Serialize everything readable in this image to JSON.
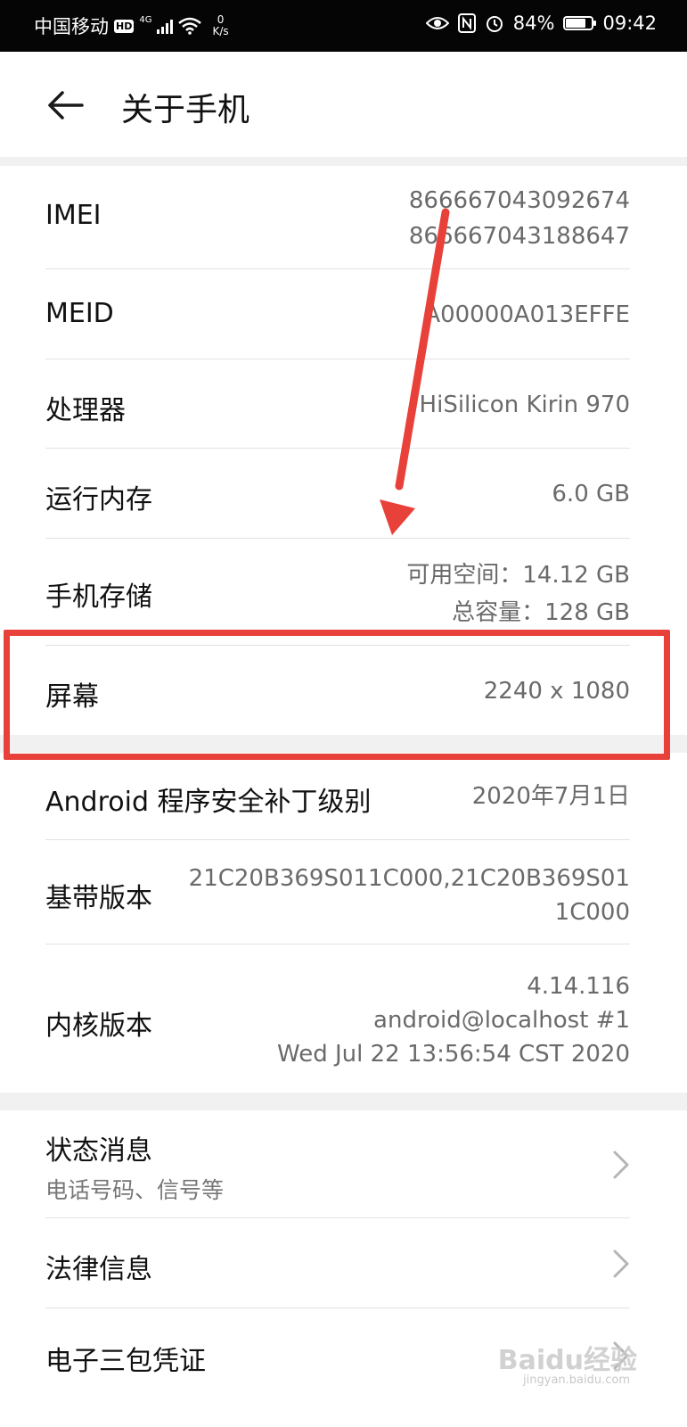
{
  "status_bar": {
    "carrier": "中国移动",
    "hd": "HD",
    "network": "4G",
    "speed_value": "0",
    "speed_unit": "K/s",
    "battery": "84%",
    "battery_level": 0.84,
    "time": "09:42"
  },
  "header": {
    "title": "关于手机"
  },
  "items": {
    "imei": {
      "label": "IMEI",
      "value1": "866667043092674",
      "value2": "866667043188647"
    },
    "meid": {
      "label": "MEID",
      "value": "A00000A013EFFE"
    },
    "processor": {
      "label": "处理器",
      "value": "HiSilicon Kirin 970"
    },
    "ram": {
      "label": "运行内存",
      "value": "6.0 GB"
    },
    "storage": {
      "label": "手机存储",
      "value1": "可用空间：14.12  GB",
      "value2": "总容量：128  GB"
    },
    "screen": {
      "label": "屏幕",
      "value": "2240 x 1080"
    },
    "security_patch": {
      "label": "Android 程序安全补丁级别",
      "value": "2020年7月1日"
    },
    "baseband": {
      "label": "基带版本",
      "value1": "21C20B369S011C000,21C20B369S01",
      "value2": "1C000"
    },
    "kernel": {
      "label": "内核版本",
      "value1": "4.14.116",
      "value2": "android@localhost #1",
      "value3": "Wed Jul 22 13:56:54 CST 2020"
    }
  },
  "nav_items": {
    "status": {
      "label": "状态消息",
      "sub": "电话号码、信号等"
    },
    "legal": {
      "label": "法律信息"
    },
    "warranty": {
      "label": "电子三包凭证"
    }
  },
  "watermark": {
    "text": "Baidu经验",
    "sub": "jingyan.baidu.com"
  },
  "colors": {
    "annotation": "#e8413a",
    "status_bar_bg": "#050505",
    "section_gap": "#f1f1f1"
  }
}
